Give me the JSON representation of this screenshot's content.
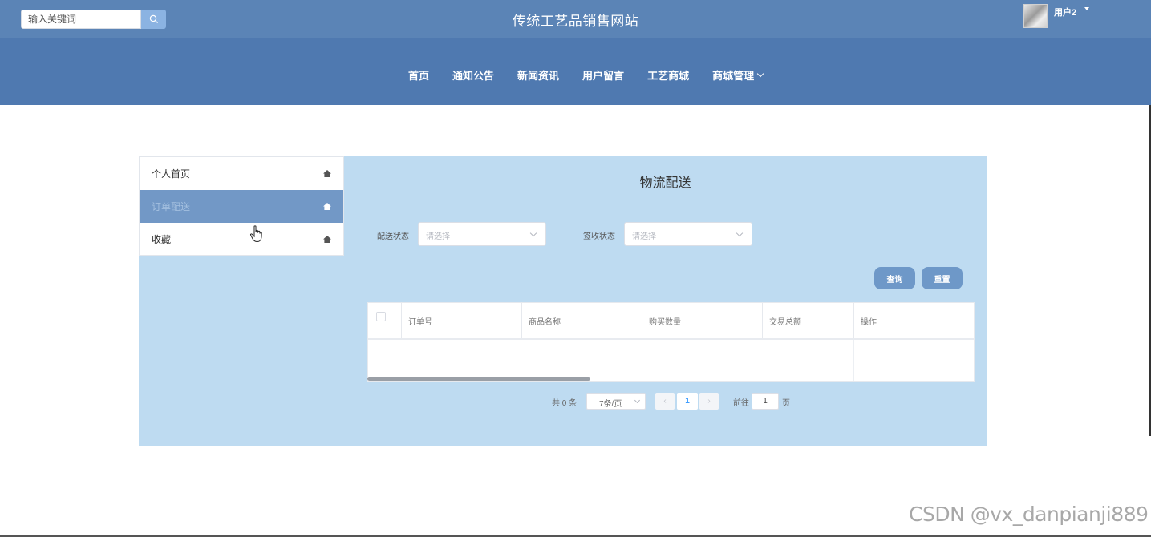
{
  "header": {
    "site_title": "传统工艺品销售网站",
    "search": {
      "placeholder": "输入关键词",
      "value": ""
    },
    "user": {
      "name": "用户2"
    }
  },
  "nav": {
    "items": [
      {
        "label": "首页"
      },
      {
        "label": "通知公告"
      },
      {
        "label": "新闻资讯"
      },
      {
        "label": "用户留言"
      },
      {
        "label": "工艺商城"
      },
      {
        "label": "商城管理",
        "has_dropdown": true
      }
    ]
  },
  "sidebar": {
    "items": [
      {
        "label": "个人首页",
        "icon": "home-icon",
        "active": false
      },
      {
        "label": "订单配送",
        "icon": "home-icon",
        "active": true
      },
      {
        "label": "收藏",
        "icon": "home-icon",
        "active": false
      }
    ]
  },
  "main": {
    "title": "物流配送",
    "filters": [
      {
        "label": "配送状态",
        "placeholder": "请选择"
      },
      {
        "label": "签收状态",
        "placeholder": "请选择"
      }
    ],
    "buttons": {
      "query": "查询",
      "reset": "重置"
    },
    "table": {
      "columns": [
        "订单号",
        "商品名称",
        "购买数量",
        "交易总额",
        "操作"
      ],
      "rows": []
    },
    "pagination": {
      "total_text": "共 0 条",
      "page_size": "7条/页",
      "current_page": "1",
      "goto_prefix": "前往",
      "goto_value": "1",
      "goto_suffix": "页"
    }
  },
  "watermark": "CSDN @vx_danpianji889",
  "colors": {
    "topbar": "#5b84b6",
    "navbar": "#4f79b0",
    "panel": "#bedbf1",
    "active_item": "#7298c6",
    "button": "#6e98c8"
  }
}
